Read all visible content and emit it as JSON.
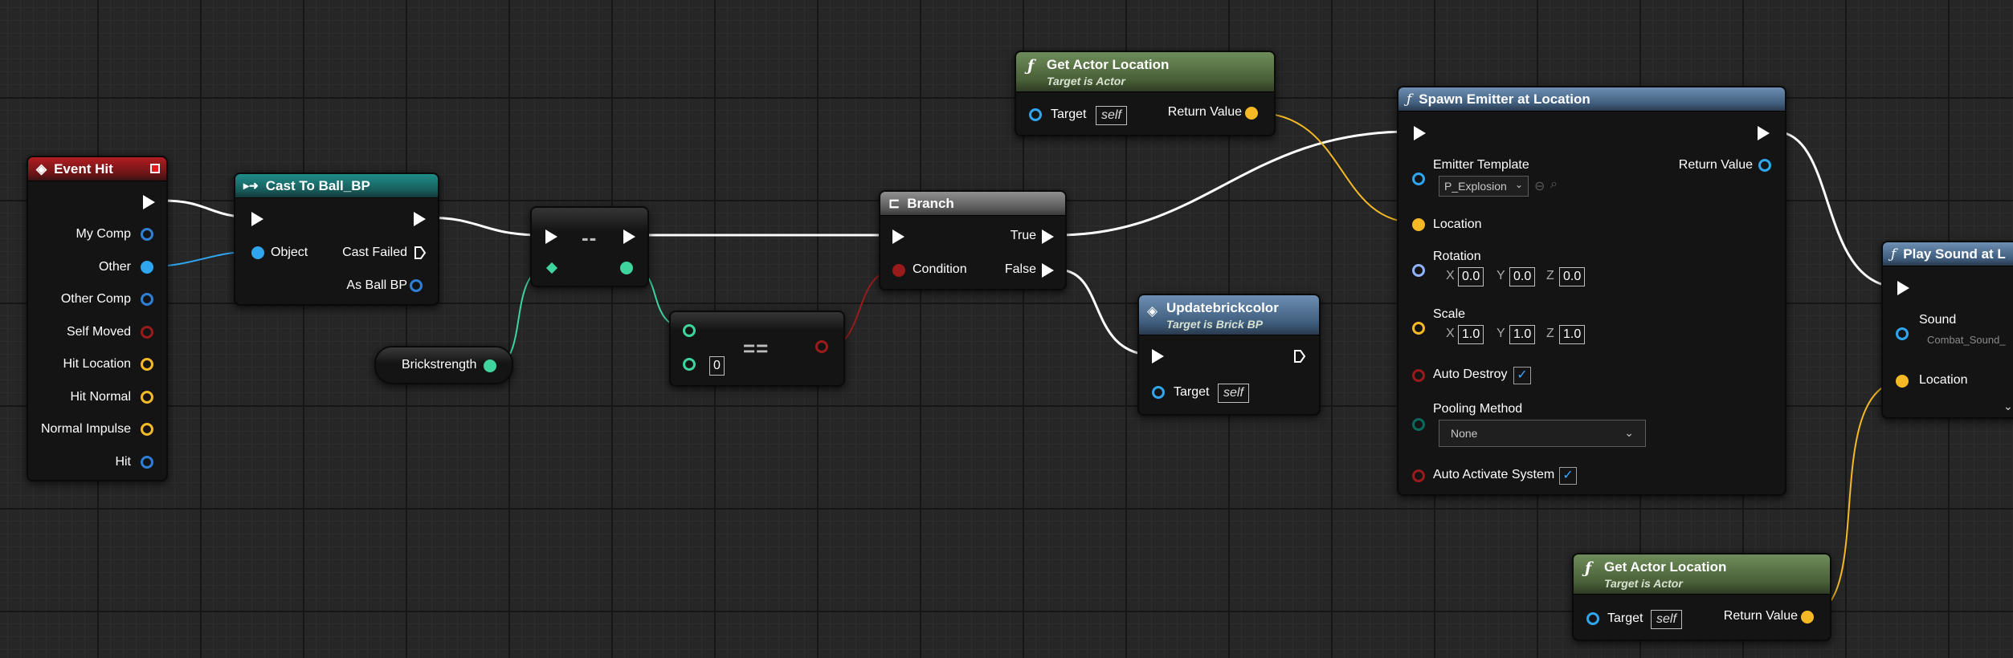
{
  "nodes": {
    "event_hit": {
      "title": "Event Hit",
      "pins": [
        "My Comp",
        "Other",
        "Other Comp",
        "Self Moved",
        "Hit Location",
        "Hit Normal",
        "Normal Impulse",
        "Hit"
      ]
    },
    "cast": {
      "title": "Cast To Ball_BP",
      "object": "Object",
      "cast_failed": "Cast Failed",
      "as_ball": "As Ball BP"
    },
    "decrement": {
      "op": "--"
    },
    "brickstrength": {
      "label": "Brickstrength"
    },
    "equals": {
      "op": "==",
      "value": "0"
    },
    "branch": {
      "title": "Branch",
      "condition": "Condition",
      "true_label": "True",
      "false_label": "False"
    },
    "get_actor_location_1": {
      "title": "Get Actor Location",
      "subtitle": "Target is Actor",
      "target": "Target",
      "target_value": "self",
      "return": "Return Value"
    },
    "updatebrickcolor": {
      "title": "Updatebrickcolor",
      "subtitle": "Target is Brick BP",
      "target": "Target",
      "target_value": "self"
    },
    "spawn_emitter": {
      "title": "Spawn Emitter at Location",
      "emitter_template": "Emitter Template",
      "emitter_value": "P_Explosion",
      "return": "Return Value",
      "location": "Location",
      "rotation": "Rotation",
      "rot": {
        "x": "0.0",
        "y": "0.0",
        "z": "0.0"
      },
      "scale": "Scale",
      "scl": {
        "x": "1.0",
        "y": "1.0",
        "z": "1.0"
      },
      "auto_destroy": "Auto Destroy",
      "pooling_method": "Pooling Method",
      "pooling_value": "None",
      "auto_activate": "Auto Activate System",
      "axis": {
        "x": "X",
        "y": "Y",
        "z": "Z"
      }
    },
    "get_actor_location_2": {
      "title": "Get Actor Location",
      "subtitle": "Target is Actor",
      "target": "Target",
      "target_value": "self",
      "return": "Return Value"
    },
    "play_sound": {
      "title": "Play Sound at L",
      "sound": "Sound",
      "sound_value": "Combat_Sound_",
      "location": "Location"
    }
  },
  "colors": {
    "exec": "#ffffff",
    "object_pin": "#2fa6ef",
    "bool_pin": "#9a1b1b",
    "vector_pin": "#f4b925",
    "struct_pin": "#2f7fd6",
    "int_pin": "#3fd49e",
    "enum_pin": "#0b6a5c"
  }
}
